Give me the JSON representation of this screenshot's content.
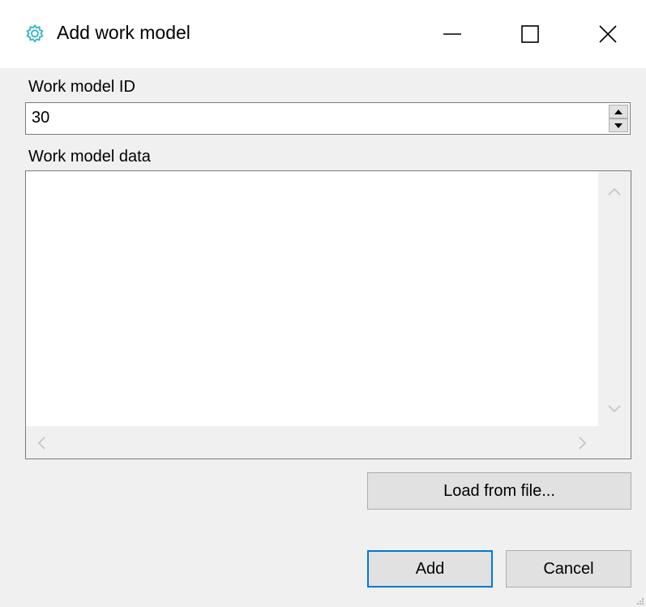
{
  "window": {
    "title": "Add work model",
    "icon": "gear-icon",
    "accent_color": "#2fb5c0",
    "controls": [
      "minimize-icon",
      "maximize-icon",
      "close-icon"
    ]
  },
  "form": {
    "id_label": "Work model ID",
    "id_value": "30",
    "data_label": "Work model data",
    "data_value": ""
  },
  "buttons": {
    "load_label": "Load from file...",
    "add_label": "Add",
    "cancel_label": "Cancel"
  }
}
